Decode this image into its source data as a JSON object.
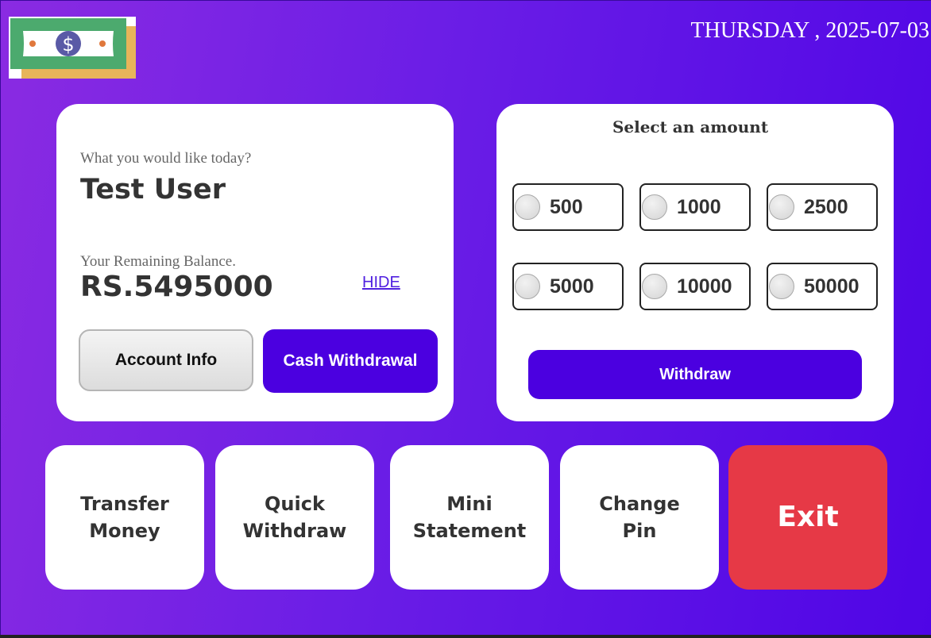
{
  "header": {
    "date": "THURSDAY , 2025-07-03"
  },
  "logo": {
    "icon": "dollar-bill-icon",
    "symbol": "$",
    "colors": {
      "bill": "#4caa6e",
      "shadow": "#e8b45a",
      "coin": "#5a5aa6",
      "dots": "#e0783c"
    }
  },
  "account_card": {
    "greeting": "What you would like today?",
    "username": "Test User",
    "balance_label": "Your Remaining Balance.",
    "balance": "RS.5495000",
    "hide_link": "HIDE",
    "account_info_button": "Account Info",
    "cash_withdrawal_button": "Cash Withdrawal"
  },
  "amount_card": {
    "title": "Select an amount",
    "amounts": [
      "500",
      "1000",
      "2500",
      "5000",
      "10000",
      "50000"
    ],
    "withdraw_button": "Withdraw"
  },
  "tiles": [
    {
      "label": "Transfer\nMoney"
    },
    {
      "label": "Quick\nWithdraw"
    },
    {
      "label": "Mini\nStatement"
    },
    {
      "label": "Change\nPin"
    },
    {
      "label": "Exit"
    }
  ],
  "colors": {
    "accent": "#4b00e0",
    "exit": "#e63946",
    "background_start": "#8a2be2",
    "background_end": "#4f05e6"
  }
}
